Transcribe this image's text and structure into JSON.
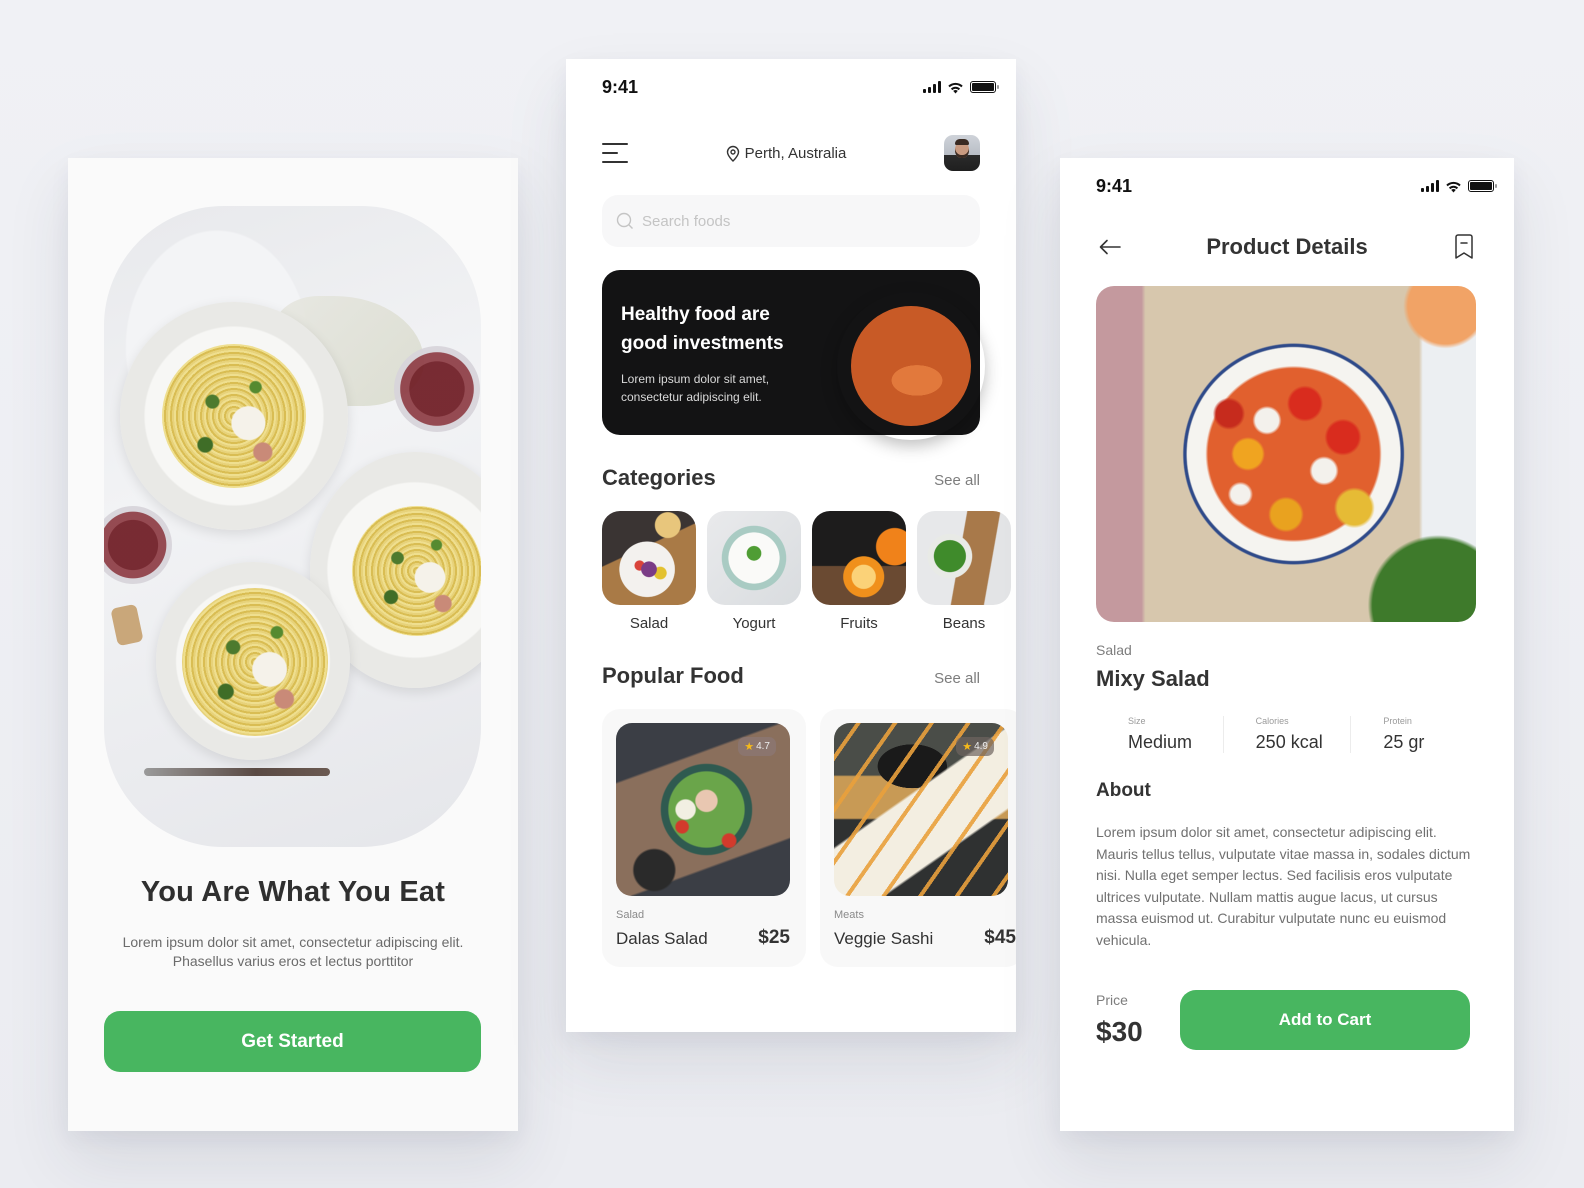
{
  "colors": {
    "accent_green": "#48b660",
    "banner_dark": "#131314",
    "star_yellow": "#f5b91a",
    "background": "#eef0f4"
  },
  "onboarding": {
    "title": "You Are What You Eat",
    "description": "Lorem ipsum dolor sit amet, consectetur adipiscing elit. Phasellus varius eros et lectus porttitor",
    "cta_label": "Get Started"
  },
  "home": {
    "status_time": "9:41",
    "location": "Perth, Australia",
    "search_placeholder": "Search foods",
    "banner": {
      "title": "Healthy food are good investments",
      "description": "Lorem ipsum dolor sit amet, consectetur adipiscing elit."
    },
    "categories": {
      "heading": "Categories",
      "see_all": "See all",
      "items": [
        {
          "label": "Salad",
          "icon": "salad-image"
        },
        {
          "label": "Yogurt",
          "icon": "yogurt-image"
        },
        {
          "label": "Fruits",
          "icon": "fruits-image"
        },
        {
          "label": "Beans",
          "icon": "beans-image"
        }
      ]
    },
    "popular": {
      "heading": "Popular Food",
      "see_all": "See all",
      "items": [
        {
          "category": "Salad",
          "name": "Dalas Salad",
          "price": "$25",
          "rating": "4.7"
        },
        {
          "category": "Meats",
          "name": "Veggie Sashi",
          "price": "$45",
          "rating": "4.9"
        }
      ]
    }
  },
  "product": {
    "status_time": "9:41",
    "page_title": "Product Details",
    "category": "Salad",
    "name": "Mixy Salad",
    "specs": [
      {
        "label": "Size",
        "value": "Medium"
      },
      {
        "label": "Calories",
        "value": "250 kcal"
      },
      {
        "label": "Protein",
        "value": "25 gr"
      }
    ],
    "about_heading": "About",
    "about_text": "Lorem ipsum dolor sit amet, consectetur adipiscing elit. Mauris tellus tellus, vulputate vitae massa in, sodales dictum nisi. Nulla eget semper lectus. Sed facilisis eros vulputate ultrices vulputate. Nullam mattis augue lacus, ut cursus massa euismod ut. Curabitur vulputate nunc eu euismod vehicula.",
    "price_label": "Price",
    "price": "$30",
    "cta_label": "Add to Cart"
  }
}
